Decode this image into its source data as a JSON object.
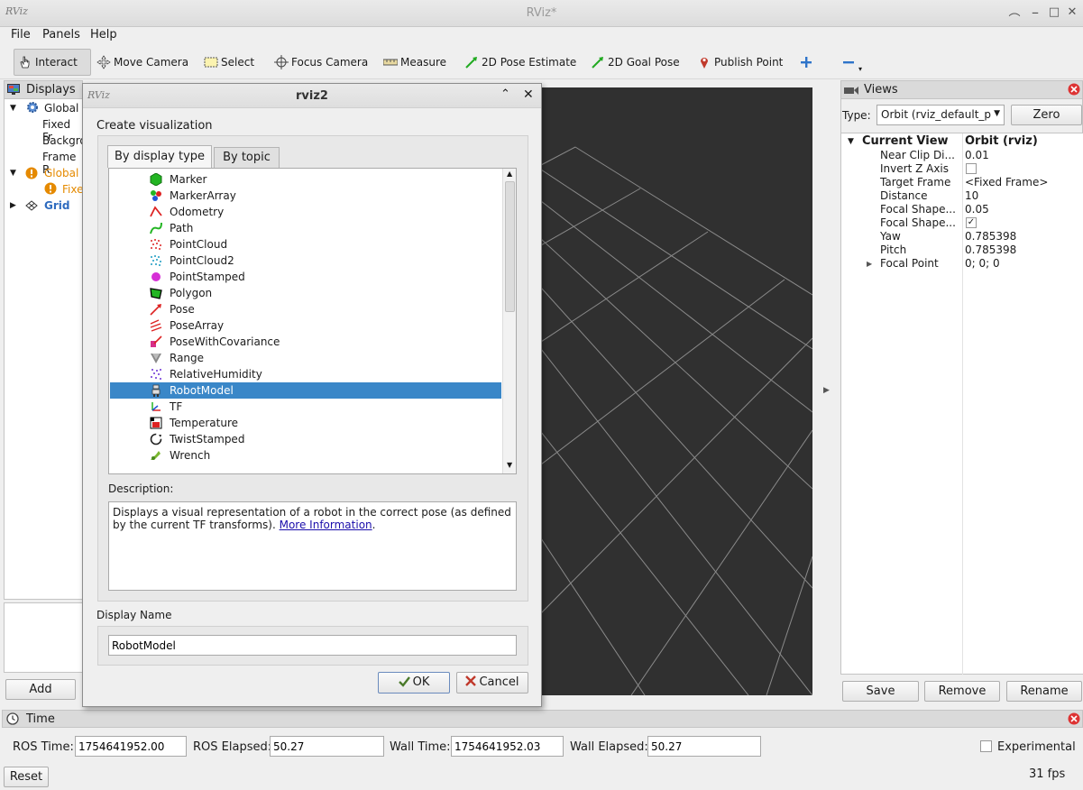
{
  "window": {
    "title": "RViz*",
    "logo": "RViz"
  },
  "menu": [
    "File",
    "Panels",
    "Help"
  ],
  "toolbar": {
    "tools": [
      {
        "label": "Interact",
        "icon": "hand-icon"
      },
      {
        "label": "Move Camera",
        "icon": "move-camera-icon"
      },
      {
        "label": "Select",
        "icon": "select-icon"
      },
      {
        "label": "Focus Camera",
        "icon": "focus-camera-icon"
      },
      {
        "label": "Measure",
        "icon": "measure-icon"
      },
      {
        "label": "2D Pose Estimate",
        "icon": "pose-estimate-icon"
      },
      {
        "label": "2D Goal Pose",
        "icon": "goal-pose-icon"
      },
      {
        "label": "Publish Point",
        "icon": "publish-point-icon"
      }
    ]
  },
  "displays": {
    "title": "Displays",
    "items": [
      {
        "label": "Global",
        "children": [
          "Fixed Fr",
          "Backgro",
          "Frame R"
        ]
      },
      {
        "label": "Global",
        "children": [
          "Fixe"
        ]
      },
      {
        "label": "Grid"
      }
    ],
    "add_label": "Add"
  },
  "dialog": {
    "title": "rviz2",
    "logo": "RViz",
    "heading": "Create visualization",
    "tabs": [
      "By display type",
      "By topic"
    ],
    "list": [
      "Marker",
      "MarkerArray",
      "Odometry",
      "Path",
      "PointCloud",
      "PointCloud2",
      "PointStamped",
      "Polygon",
      "Pose",
      "PoseArray",
      "PoseWithCovariance",
      "Range",
      "RelativeHumidity",
      "RobotModel",
      "TF",
      "Temperature",
      "TwistStamped",
      "Wrench"
    ],
    "selected": "RobotModel",
    "description_label": "Description:",
    "description_text": "Displays a visual representation of a robot in the correct pose (as defined by the current TF transforms).",
    "description_link": "More Information",
    "description_tail": ".",
    "display_name_label": "Display Name",
    "display_name_value": "RobotModel",
    "ok_label": "OK",
    "cancel_label": "Cancel"
  },
  "views": {
    "title": "Views",
    "type_label": "Type:",
    "type_value": "Orbit (rviz_default_p",
    "zero_label": "Zero",
    "current_view": "Current View",
    "current_view_value": "Orbit (rviz)",
    "props": [
      {
        "name": "Near Clip Di...",
        "value": "0.01"
      },
      {
        "name": "Invert Z Axis",
        "value": ""
      },
      {
        "name": "Target Frame",
        "value": "<Fixed Frame>"
      },
      {
        "name": "Distance",
        "value": "10"
      },
      {
        "name": "Focal Shape...",
        "value": "0.05"
      },
      {
        "name": "Focal Shape...",
        "value": ""
      },
      {
        "name": "Yaw",
        "value": "0.785398"
      },
      {
        "name": "Pitch",
        "value": "0.785398"
      },
      {
        "name": "Focal Point",
        "value": "0; 0; 0"
      }
    ],
    "save_label": "Save",
    "remove_label": "Remove",
    "rename_label": "Rename"
  },
  "time": {
    "title": "Time",
    "ros_time_label": "ROS Time:",
    "ros_time": "1754641952.00",
    "ros_elapsed_label": "ROS Elapsed:",
    "ros_elapsed": "50.27",
    "wall_time_label": "Wall Time:",
    "wall_time": "1754641952.03",
    "wall_elapsed_label": "Wall Elapsed:",
    "wall_elapsed": "50.27",
    "experimental_label": "Experimental",
    "reset_label": "Reset",
    "fps": "31 fps"
  },
  "colors": {
    "selection": "#3a87c8",
    "warning": "#e58a00",
    "grid_bg": "#303030",
    "link": "#1a0dab"
  }
}
